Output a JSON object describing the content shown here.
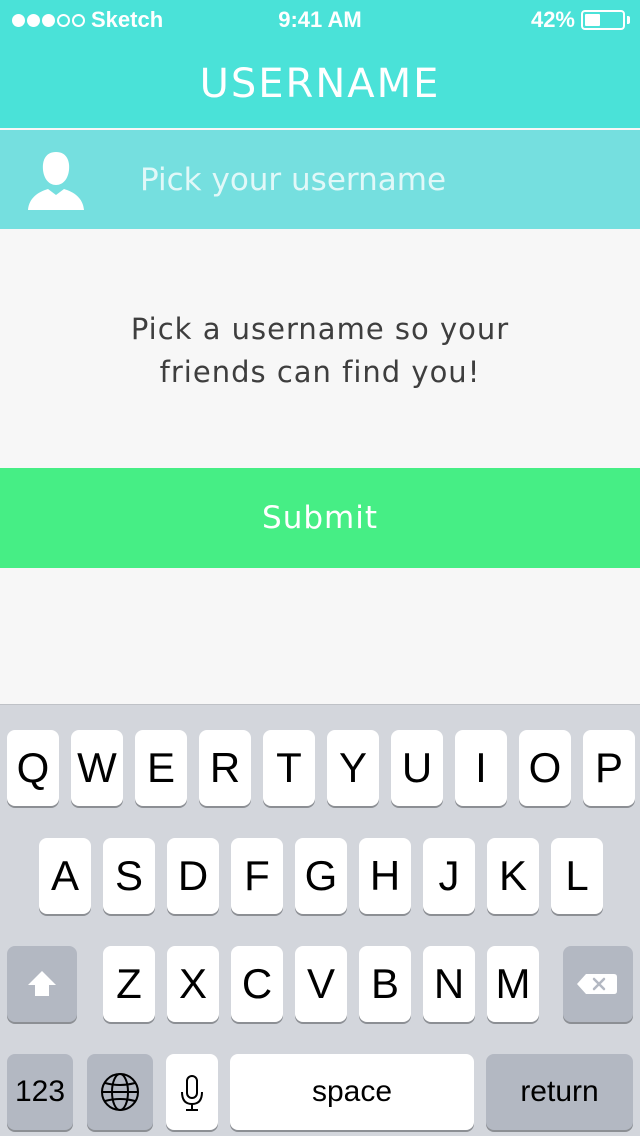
{
  "status": {
    "carrier": "Sketch",
    "time": "9:41 AM",
    "battery_pct": "42%",
    "battery_level": 0.42,
    "signal_bars": 5,
    "signal_filled": 3
  },
  "nav": {
    "title": "USERNAME"
  },
  "username_field": {
    "placeholder": "Pick your username",
    "value": ""
  },
  "message": {
    "line1": "Pick a username so your",
    "line2": "friends can find you!"
  },
  "submit": {
    "label": "Submit"
  },
  "keyboard": {
    "row1": [
      "Q",
      "W",
      "E",
      "R",
      "T",
      "Y",
      "U",
      "I",
      "O",
      "P"
    ],
    "row2": [
      "A",
      "S",
      "D",
      "F",
      "G",
      "H",
      "J",
      "K",
      "L"
    ],
    "row3": [
      "Z",
      "X",
      "C",
      "V",
      "B",
      "N",
      "M"
    ],
    "numbers": "123",
    "space": "space",
    "return": "return",
    "icons": {
      "shift": "shift-icon",
      "delete": "delete-icon",
      "globe": "globe-icon",
      "mic": "microphone-icon"
    }
  },
  "colors": {
    "header": "#4ae2d8",
    "field_row": "#75dfdf",
    "submit": "#46ee85",
    "background": "#f7f7f7",
    "keyboard": "#d3d6dc"
  }
}
